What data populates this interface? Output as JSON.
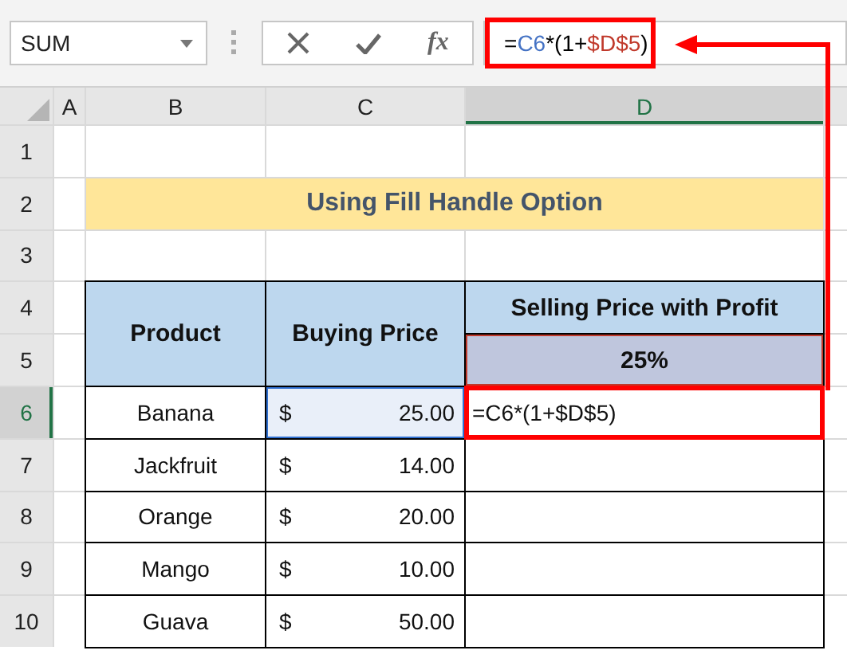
{
  "name_box": {
    "value": "SUM"
  },
  "formula_bar": {
    "fx": "fx",
    "formula": [
      {
        "text": "=",
        "color": "#000000"
      },
      {
        "text": "C6",
        "color": "#4472c4"
      },
      {
        "text": "*(1+",
        "color": "#000000"
      },
      {
        "text": "$D$5",
        "color": "#c0392b"
      },
      {
        "text": ")",
        "color": "#000000"
      }
    ],
    "annotated": true
  },
  "columns": [
    {
      "label": "A",
      "selected": false
    },
    {
      "label": "B",
      "selected": false
    },
    {
      "label": "C",
      "selected": false
    },
    {
      "label": "D",
      "selected": true
    }
  ],
  "rows": [
    {
      "label": "1",
      "selected": false
    },
    {
      "label": "2",
      "selected": false
    },
    {
      "label": "3",
      "selected": false
    },
    {
      "label": "4",
      "selected": false
    },
    {
      "label": "5",
      "selected": false
    },
    {
      "label": "6",
      "selected": true
    },
    {
      "label": "7",
      "selected": false
    },
    {
      "label": "8",
      "selected": false
    },
    {
      "label": "9",
      "selected": false
    },
    {
      "label": "10",
      "selected": false
    }
  ],
  "title": "Using Fill Handle Option",
  "table": {
    "headers": {
      "product": "Product",
      "buying_price": "Buying Price",
      "selling_price": "Selling Price with Profit",
      "profit_rate": "25%"
    },
    "rows": [
      {
        "product": "Banana",
        "currency": "$",
        "price": "25.00",
        "selling_price": "=C6*(1+$D$5)",
        "referenced": true,
        "annotated": true
      },
      {
        "product": "Jackfruit",
        "currency": "$",
        "price": "14.00",
        "referenced": false,
        "annotated": false
      },
      {
        "product": "Orange",
        "currency": "$",
        "price": "20.00",
        "referenced": false,
        "annotated": false
      },
      {
        "product": "Mango",
        "currency": "$",
        "price": "10.00",
        "referenced": false,
        "annotated": false
      },
      {
        "product": "Guava",
        "currency": "$",
        "price": "50.00",
        "referenced": false,
        "annotated": false
      }
    ]
  }
}
